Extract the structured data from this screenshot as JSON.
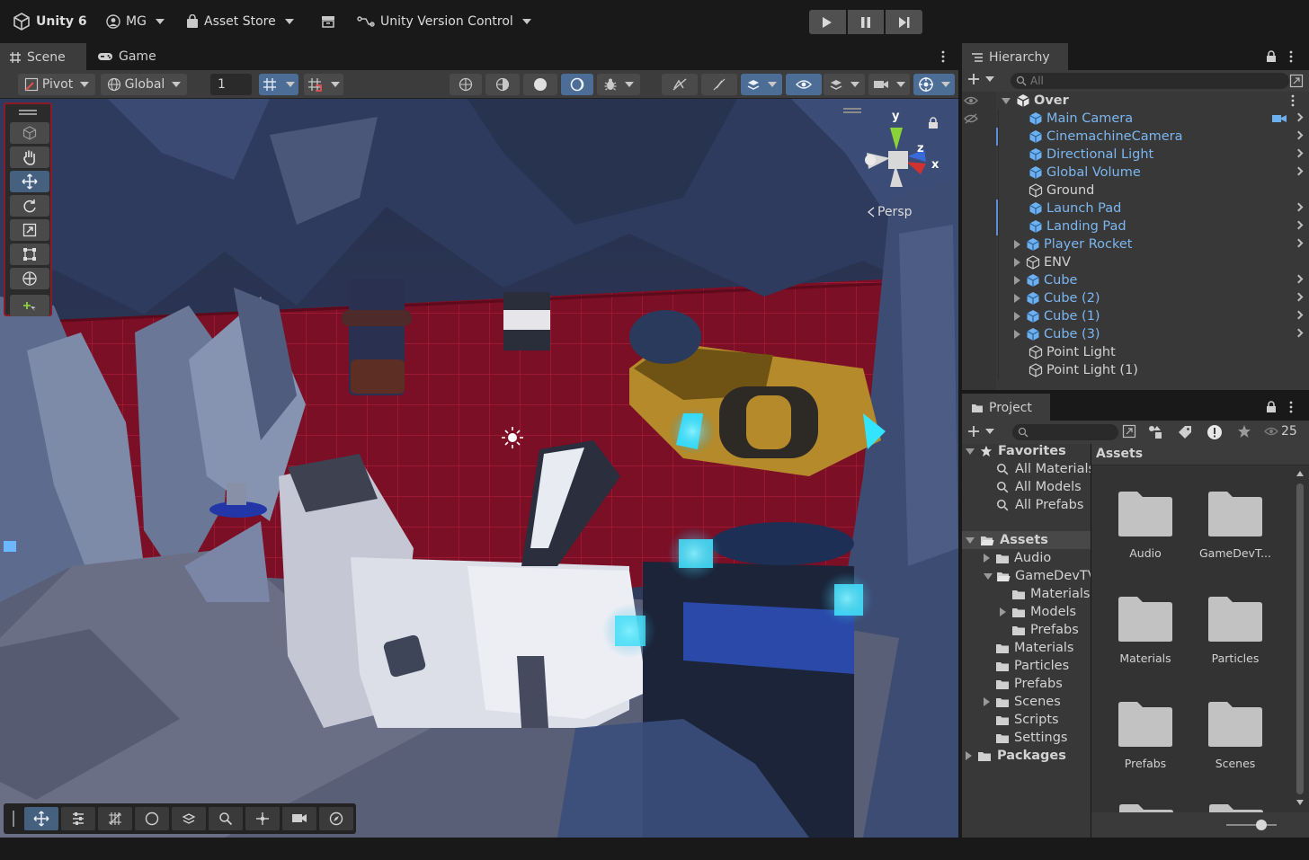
{
  "topbar": {
    "app_name": "Unity 6",
    "account": "MG",
    "asset_store": "Asset Store",
    "version_control": "Unity Version Control"
  },
  "scene_view": {
    "tabs": [
      {
        "label": "Scene"
      },
      {
        "label": "Game"
      }
    ],
    "pivot_label": "Pivot",
    "global_label": "Global",
    "grid_increment_value": "1",
    "persp_label": "Persp",
    "gizmo_axes": {
      "y": "y",
      "z": "z",
      "x": "x"
    }
  },
  "hierarchy": {
    "tab": "Hierarchy",
    "search_placeholder": "All",
    "scene_name": "Over",
    "items": [
      {
        "name": "Main Camera",
        "prefab": true
      },
      {
        "name": "CinemachineCamera",
        "prefab": true
      },
      {
        "name": "Directional Light",
        "prefab": true
      },
      {
        "name": "Global Volume",
        "prefab": true
      },
      {
        "name": "Ground",
        "prefab": false
      },
      {
        "name": "Launch Pad",
        "prefab": true
      },
      {
        "name": "Landing Pad",
        "prefab": true
      },
      {
        "name": "Player Rocket",
        "prefab": true
      },
      {
        "name": "ENV",
        "prefab": false
      },
      {
        "name": "Cube",
        "prefab": true
      },
      {
        "name": "Cube (2)",
        "prefab": true
      },
      {
        "name": "Cube (1)",
        "prefab": true
      },
      {
        "name": "Cube (3)",
        "prefab": true
      },
      {
        "name": "Point Light",
        "prefab": false
      },
      {
        "name": "Point Light (1)",
        "prefab": false
      }
    ]
  },
  "project": {
    "tab": "Project",
    "hidden_count": "25",
    "breadcrumb": "Assets",
    "tree": {
      "favorites": "Favorites",
      "all_materials": "All Materials",
      "all_models": "All Models",
      "all_prefabs": "All Prefabs",
      "assets": "Assets",
      "audio": "Audio",
      "gamedev": "GameDevTV",
      "gd_materials": "Materials",
      "gd_models": "Models",
      "gd_prefabs": "Prefabs",
      "materials": "Materials",
      "particles": "Particles",
      "prefabs": "Prefabs",
      "scenes": "Scenes",
      "scripts": "Scripts",
      "settings": "Settings",
      "packages": "Packages"
    },
    "grid": [
      "Audio",
      "GameDevT...",
      "Materials",
      "Particles",
      "Prefabs",
      "Scenes"
    ]
  },
  "colors": {
    "accent_blue": "#46607f",
    "prefab_text": "#7cb6ef",
    "tools_border": "#8a1c2a",
    "floor": "#7e1026"
  }
}
